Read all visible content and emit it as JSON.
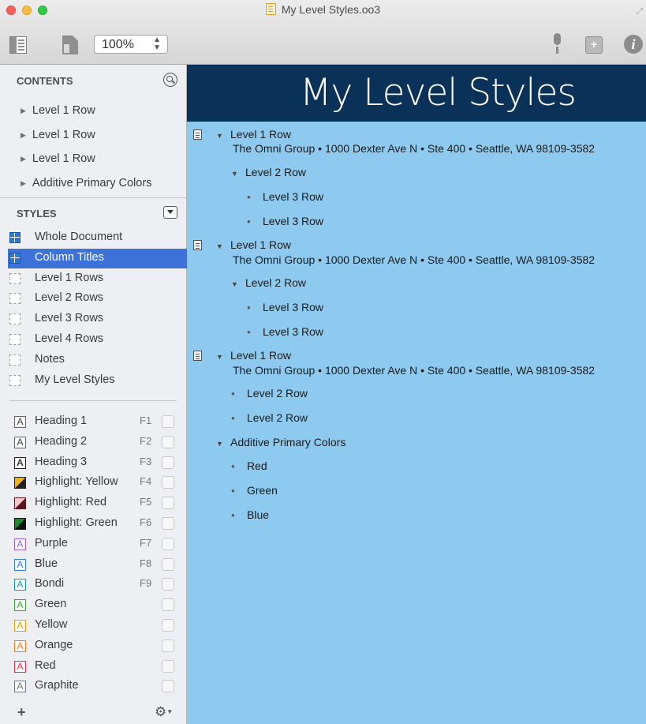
{
  "window": {
    "title": "My Level Styles.oo3",
    "zoom": "100%"
  },
  "sidebar": {
    "contents_heading": "CONTENTS",
    "contents": [
      {
        "label": "Level 1 Row"
      },
      {
        "label": "Level 1 Row"
      },
      {
        "label": "Level 1 Row"
      },
      {
        "label": "Additive Primary Colors"
      }
    ],
    "styles_heading": "STYLES",
    "styles": [
      {
        "label": "Whole Document",
        "icon": "document-style-icon"
      },
      {
        "label": "Column Titles",
        "icon": "column-titles-style-icon",
        "selected": true
      },
      {
        "label": "Level 1 Rows",
        "icon": "level-style-icon"
      },
      {
        "label": "Level 2 Rows",
        "icon": "level-style-icon"
      },
      {
        "label": "Level 3 Rows",
        "icon": "level-style-icon"
      },
      {
        "label": "Level 4 Rows",
        "icon": "level-style-icon"
      },
      {
        "label": "Notes",
        "icon": "level-style-icon"
      },
      {
        "label": "My Level Styles",
        "icon": "level-style-icon"
      }
    ],
    "named_styles": [
      {
        "label": "Heading 1",
        "key": "F1",
        "glyph": "A",
        "swatch": "heading-1"
      },
      {
        "label": "Heading 2",
        "key": "F2",
        "glyph": "A",
        "swatch": "heading-2"
      },
      {
        "label": "Heading 3",
        "key": "F3",
        "glyph": "A",
        "swatch": "heading-3"
      },
      {
        "label": "Highlight: Yellow",
        "key": "F4",
        "glyph": "",
        "swatch": "highlight-yellow"
      },
      {
        "label": "Highlight: Red",
        "key": "F5",
        "glyph": "",
        "swatch": "highlight-red"
      },
      {
        "label": "Highlight: Green",
        "key": "F6",
        "glyph": "",
        "swatch": "highlight-green"
      },
      {
        "label": "Purple",
        "key": "F7",
        "glyph": "A",
        "color": "#9b59d0"
      },
      {
        "label": "Blue",
        "key": "F8",
        "glyph": "A",
        "color": "#2f80e4"
      },
      {
        "label": "Bondi",
        "key": "F9",
        "glyph": "A",
        "color": "#0fa0b0"
      },
      {
        "label": "Green",
        "key": "",
        "glyph": "A",
        "color": "#3aa635"
      },
      {
        "label": "Yellow",
        "key": "",
        "glyph": "A",
        "color": "#e5a300"
      },
      {
        "label": "Orange",
        "key": "",
        "glyph": "A",
        "color": "#f07b1e"
      },
      {
        "label": "Red",
        "key": "",
        "glyph": "A",
        "color": "#e0334a"
      },
      {
        "label": "Graphite",
        "key": "",
        "glyph": "A",
        "color": "#6d7785"
      }
    ],
    "add_label": "+",
    "gear_label": "⚙"
  },
  "document": {
    "banner_title": "My Level Styles",
    "colors": {
      "banner_bg": "#0a3158",
      "canvas_bg": "#8ec9f0",
      "selection": "#3d72d9"
    },
    "rows": [
      {
        "kind": "row",
        "level": 1,
        "marker": "triangle",
        "has_note": true,
        "text": "Level 1 Row"
      },
      {
        "kind": "note",
        "level": 1,
        "text": "The Omni Group • 1000 Dexter Ave N • Ste 400 • Seattle, WA 98109-3582"
      },
      {
        "kind": "row",
        "level": 2,
        "marker": "triangle",
        "text": "Level 2 Row"
      },
      {
        "kind": "row",
        "level": 3,
        "marker": "bullet",
        "text": "Level 3 Row"
      },
      {
        "kind": "row",
        "level": 3,
        "marker": "bullet",
        "text": "Level 3 Row"
      },
      {
        "kind": "row",
        "level": 1,
        "marker": "triangle",
        "has_note": true,
        "text": "Level 1 Row"
      },
      {
        "kind": "note",
        "level": 1,
        "text": "The Omni Group • 1000 Dexter Ave N • Ste 400 • Seattle, WA 98109-3582"
      },
      {
        "kind": "row",
        "level": 2,
        "marker": "triangle",
        "text": "Level 2 Row"
      },
      {
        "kind": "row",
        "level": 3,
        "marker": "bullet",
        "text": "Level 3 Row"
      },
      {
        "kind": "row",
        "level": 3,
        "marker": "bullet",
        "text": "Level 3 Row"
      },
      {
        "kind": "row",
        "level": 1,
        "marker": "triangle",
        "has_note": true,
        "text": "Level 1 Row"
      },
      {
        "kind": "note",
        "level": 1,
        "text": "The Omni Group • 1000 Dexter Ave N • Ste 400 • Seattle, WA 98109-3582"
      },
      {
        "kind": "row",
        "level": 2,
        "marker": "bullet",
        "text": "Level 2 Row"
      },
      {
        "kind": "row",
        "level": 2,
        "marker": "bullet",
        "text": "Level 2 Row"
      },
      {
        "kind": "row",
        "level": 1,
        "marker": "triangle",
        "text": "Additive Primary Colors"
      },
      {
        "kind": "row",
        "level": 2,
        "marker": "bullet",
        "text": "Red"
      },
      {
        "kind": "row",
        "level": 2,
        "marker": "bullet",
        "text": "Green"
      },
      {
        "kind": "row",
        "level": 2,
        "marker": "bullet",
        "text": "Blue"
      }
    ]
  }
}
